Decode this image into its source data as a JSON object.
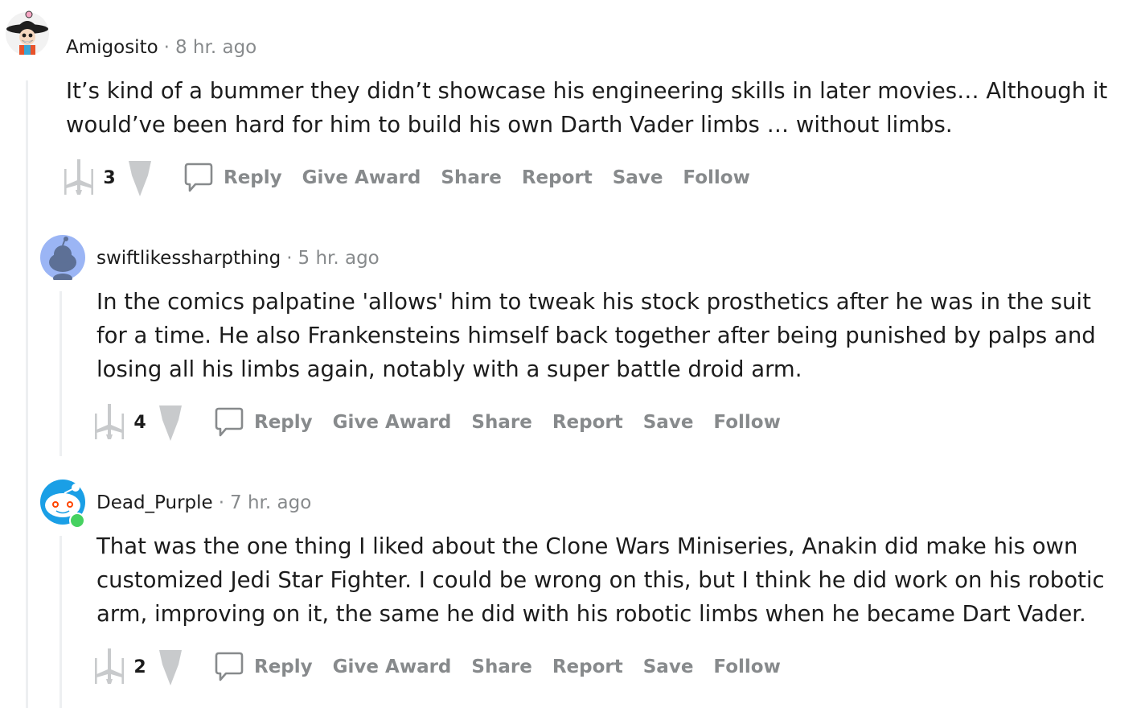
{
  "comments": [
    {
      "username": "Amigosito",
      "separator": "·",
      "time": "8 hr. ago",
      "text": "It’s kind of a bummer they didn’t showcase his engineering skills in later movies… Although it would’ve been hard for him to build his own Darth Vader limbs … without limbs.",
      "score": "3",
      "actions": {
        "reply": "Reply",
        "give_award": "Give Award",
        "share": "Share",
        "report": "Report",
        "save": "Save",
        "follow": "Follow"
      }
    },
    {
      "username": "swiftlikessharpthing",
      "separator": "·",
      "time": "5 hr. ago",
      "text": "In the comics palpatine 'allows' him to tweak his stock prosthetics after he was in the suit for a time. He also Frankensteins himself back together after being punished by palps and losing all his limbs again, notably with a super battle droid arm.",
      "score": "4",
      "actions": {
        "reply": "Reply",
        "give_award": "Give Award",
        "share": "Share",
        "report": "Report",
        "save": "Save",
        "follow": "Follow"
      }
    },
    {
      "username": "Dead_Purple",
      "separator": "·",
      "time": "7 hr. ago",
      "text": "That was the one thing I liked about the Clone Wars Miniseries, Anakin did make his own customized Jedi Star Fighter. I could be wrong on this, but I think he did work on his robotic arm, improving on it, the same he did with his robotic limbs when he became Dart Vader.",
      "score": "2",
      "actions": {
        "reply": "Reply",
        "give_award": "Give Award",
        "share": "Share",
        "report": "Report",
        "save": "Save",
        "follow": "Follow"
      }
    }
  ],
  "icons": {
    "upvote": "xwing-upvote-icon",
    "downvote": "tie-downvote-icon",
    "reply": "speech-bubble-icon"
  },
  "colors": {
    "meta_gray": "#878a8c",
    "thread_line": "#edeff1",
    "vote_icon": "#c8cacc",
    "online": "#46d160",
    "avatar_blue": "#9bb5f5",
    "avatar_sky": "#1a9fe6"
  }
}
